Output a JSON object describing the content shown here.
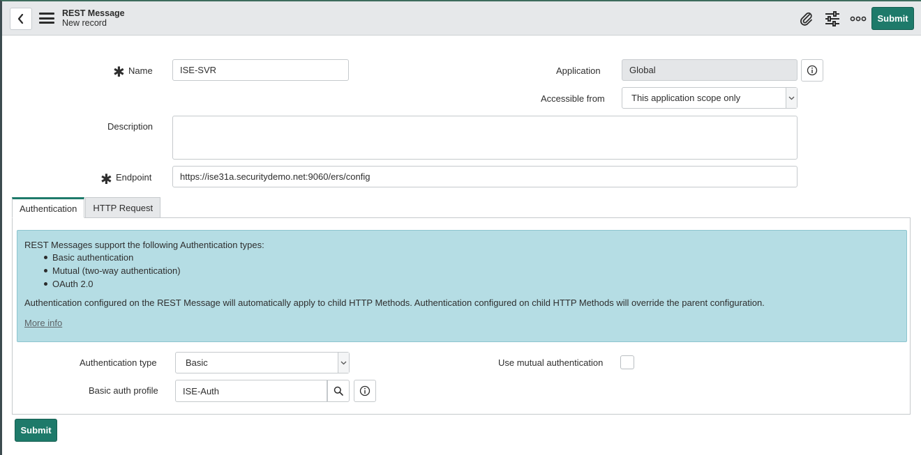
{
  "header": {
    "title": "REST Message",
    "subtitle": "New record",
    "submit_label": "Submit",
    "icons": [
      "back-icon",
      "menu-icon",
      "paperclip-icon",
      "sliders-icon",
      "more-icon"
    ]
  },
  "form": {
    "name": {
      "label": "Name",
      "value": "ISE-SVR",
      "required": true
    },
    "application": {
      "label": "Application",
      "value": "Global"
    },
    "accessible_from": {
      "label": "Accessible from",
      "value": "This application scope only"
    },
    "description": {
      "label": "Description",
      "value": ""
    },
    "endpoint": {
      "label": "Endpoint",
      "value": "https://ise31a.securitydemo.net:9060/ers/config",
      "required": true
    }
  },
  "tabs": [
    {
      "label": "Authentication",
      "active": true
    },
    {
      "label": "HTTP Request",
      "active": false
    }
  ],
  "info_box": {
    "intro": "REST Messages support the following Authentication types:",
    "items": [
      "Basic authentication",
      "Mutual (two-way authentication)",
      "OAuth 2.0"
    ],
    "description": "Authentication configured on the REST Message will automatically apply to child HTTP Methods. Authentication configured on child HTTP Methods will override the parent configuration.",
    "more_info": "More info"
  },
  "auth": {
    "type_label": "Authentication type",
    "type_value": "Basic",
    "mutual_label": "Use mutual authentication",
    "mutual_checked": false,
    "profile_label": "Basic auth profile",
    "profile_value": "ISE-Auth"
  },
  "footer": {
    "submit_label": "Submit"
  },
  "colors": {
    "primary": "#1e7a6a",
    "info_bg": "#b5dde4",
    "header_bg": "#e6e8ea"
  }
}
